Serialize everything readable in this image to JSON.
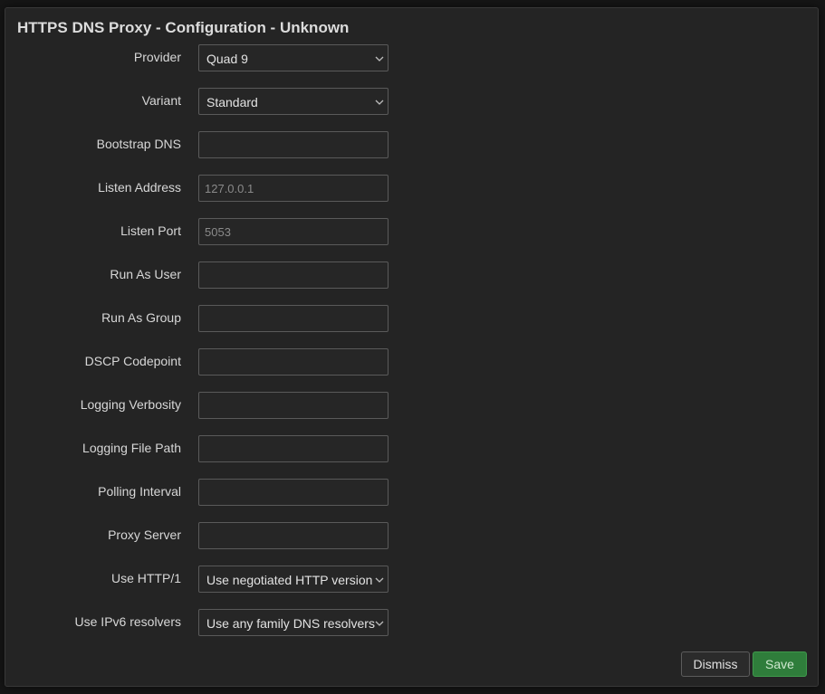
{
  "dialog": {
    "title": "HTTPS DNS Proxy - Configuration - Unknown"
  },
  "fields": {
    "provider": {
      "label": "Provider",
      "value": "Quad 9"
    },
    "variant": {
      "label": "Variant",
      "value": "Standard"
    },
    "bootstrap_dns": {
      "label": "Bootstrap DNS",
      "value": "",
      "placeholder": ""
    },
    "listen_address": {
      "label": "Listen Address",
      "value": "",
      "placeholder": "127.0.0.1"
    },
    "listen_port": {
      "label": "Listen Port",
      "value": "",
      "placeholder": "5053"
    },
    "run_as_user": {
      "label": "Run As User",
      "value": "",
      "placeholder": ""
    },
    "run_as_group": {
      "label": "Run As Group",
      "value": "",
      "placeholder": ""
    },
    "dscp_codepoint": {
      "label": "DSCP Codepoint",
      "value": "",
      "placeholder": ""
    },
    "logging_verbosity": {
      "label": "Logging Verbosity",
      "value": "",
      "placeholder": ""
    },
    "logging_file_path": {
      "label": "Logging File Path",
      "value": "",
      "placeholder": ""
    },
    "polling_interval": {
      "label": "Polling Interval",
      "value": "",
      "placeholder": ""
    },
    "proxy_server": {
      "label": "Proxy Server",
      "value": "",
      "placeholder": ""
    },
    "use_http1": {
      "label": "Use HTTP/1",
      "value": "Use negotiated HTTP version"
    },
    "use_ipv6": {
      "label": "Use IPv6 resolvers",
      "value": "Use any family DNS resolvers"
    }
  },
  "footer": {
    "dismiss_label": "Dismiss",
    "save_label": "Save"
  },
  "icons": {
    "select_arrow": "chevron-down-icon"
  },
  "colors": {
    "modal_bg": "#242424",
    "input_border": "#5a5a5a",
    "save_bg": "#2f7d3b",
    "text": "#d7d7d7"
  }
}
